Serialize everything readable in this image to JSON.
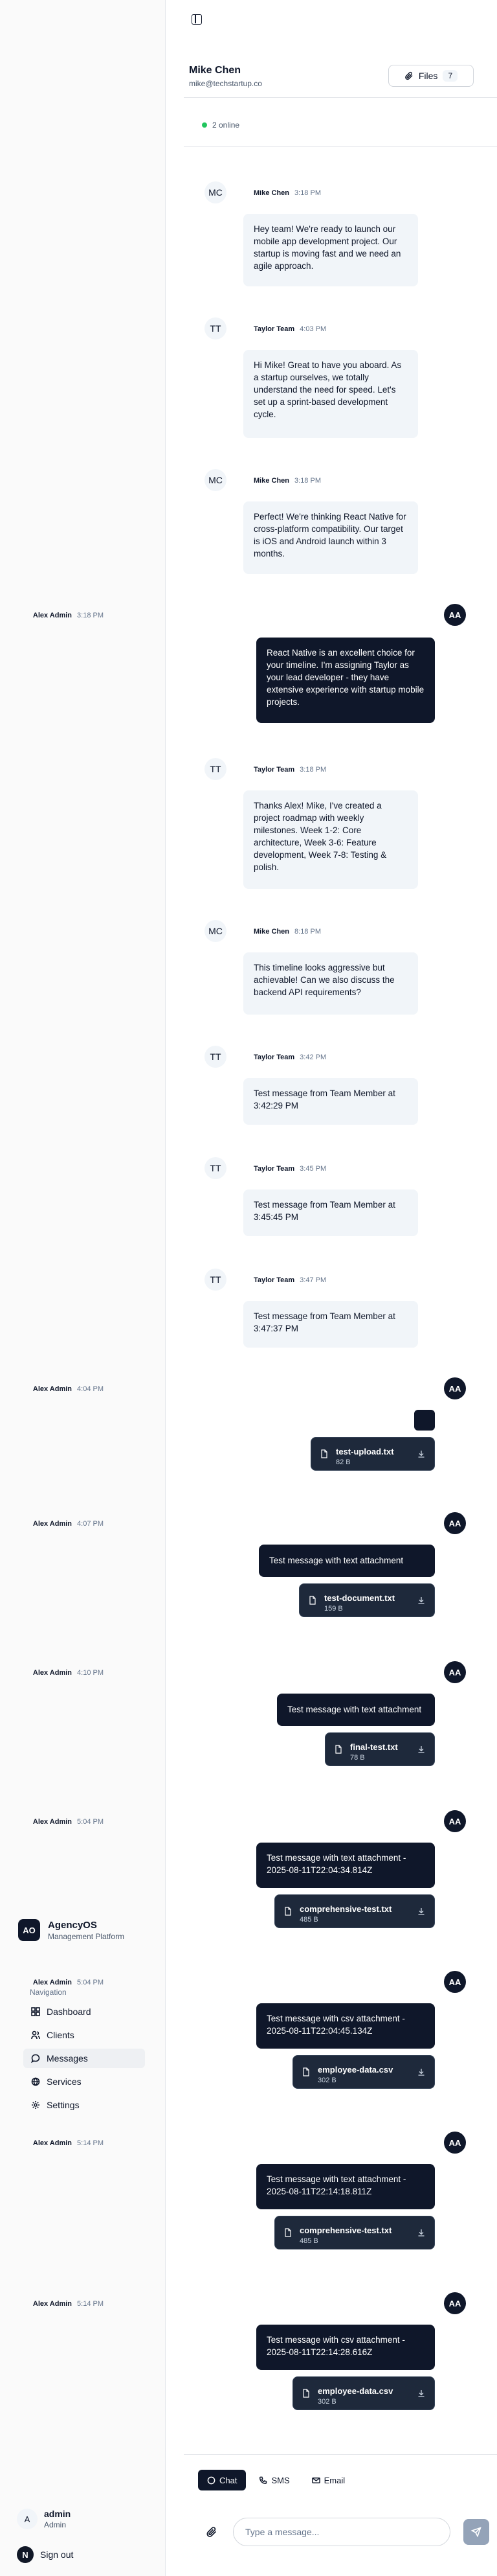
{
  "app": {
    "name": "AgencyOS",
    "subtitle": "Management Platform",
    "logo_text": "AO"
  },
  "sidebar": {
    "heading": "Navigation",
    "items": [
      {
        "label": "Dashboard",
        "icon": "dashboard-icon"
      },
      {
        "label": "Clients",
        "icon": "users-icon"
      },
      {
        "label": "Messages",
        "icon": "chat-icon",
        "active": true
      },
      {
        "label": "Services",
        "icon": "globe-icon"
      },
      {
        "label": "Settings",
        "icon": "gear-icon"
      }
    ],
    "user": {
      "initial": "A",
      "name": "admin",
      "role": "Admin"
    },
    "signout": {
      "badge": "N",
      "label": "Sign out"
    }
  },
  "chat": {
    "contact_name": "Mike Chen",
    "contact_email": "mike@techstartup.co",
    "files_label": "Files",
    "files_count": "7",
    "online_text": "2 online"
  },
  "messages": [
    {
      "avatar": "MC",
      "name": "Mike Chen",
      "time": "3:18 PM",
      "text": "Hey team! We're ready to launch our mobile app development project. Our startup is moving fast and we need an agile approach."
    },
    {
      "avatar": "TT",
      "name": "Taylor Team",
      "time": "4:03 PM",
      "text": "Hi Mike! Great to have you aboard. As a startup ourselves, we totally understand the need for speed. Let's set up a sprint-based development cycle."
    },
    {
      "avatar": "MC",
      "name": "Mike Chen",
      "time": "3:18 PM",
      "text": "Perfect! We're thinking React Native for cross-platform compatibility. Our target is iOS and Android launch within 3 months."
    },
    {
      "avatar": "AA",
      "name": "Alex Admin",
      "time": "3:18 PM",
      "text": "React Native is an excellent choice for your timeline. I'm assigning Taylor as your lead developer - they have extensive experience with startup mobile projects."
    },
    {
      "avatar": "TT",
      "name": "Taylor Team",
      "time": "3:18 PM",
      "text": "Thanks Alex! Mike, I've created a project roadmap with weekly milestones. Week 1-2: Core architecture, Week 3-6: Feature development, Week 7-8: Testing & polish."
    },
    {
      "avatar": "MC",
      "name": "Mike Chen",
      "time": "8:18 PM",
      "text": "This timeline looks aggressive but achievable! Can we also discuss the backend API requirements?"
    },
    {
      "avatar": "TT",
      "name": "Taylor Team",
      "time": "3:42 PM",
      "text": "Test message from Team Member at 3:42:29 PM"
    },
    {
      "avatar": "TT",
      "name": "Taylor Team",
      "time": "3:45 PM",
      "text": "Test message from Team Member at 3:45:45 PM"
    },
    {
      "avatar": "TT",
      "name": "Taylor Team",
      "time": "3:47 PM",
      "text": "Test message from Team Member at 3:47:37 PM"
    },
    {
      "avatar": "AA",
      "name": "Alex Admin",
      "time": "4:04 PM",
      "text": "",
      "file": {
        "name": "test-upload.txt",
        "size": "82 B"
      }
    },
    {
      "avatar": "AA",
      "name": "Alex Admin",
      "time": "4:07 PM",
      "text": "Test message with text attachment",
      "file": {
        "name": "test-document.txt",
        "size": "159 B"
      }
    },
    {
      "avatar": "AA",
      "name": "Alex Admin",
      "time": "4:10 PM",
      "text": "Test message with text attachment",
      "file": {
        "name": "final-test.txt",
        "size": "78 B"
      }
    },
    {
      "avatar": "AA",
      "name": "Alex Admin",
      "time": "5:04 PM",
      "text": "Test message with text attachment - 2025-08-11T22:04:34.814Z",
      "file": {
        "name": "comprehensive-test.txt",
        "size": "485 B"
      }
    },
    {
      "avatar": "AA",
      "name": "Alex Admin",
      "time": "5:04 PM",
      "text": "Test message with csv attachment - 2025-08-11T22:04:45.134Z",
      "file": {
        "name": "employee-data.csv",
        "size": "302 B"
      }
    },
    {
      "avatar": "AA",
      "name": "Alex Admin",
      "time": "5:14 PM",
      "text": "Test message with text attachment - 2025-08-11T22:14:18.811Z",
      "file": {
        "name": "comprehensive-test.txt",
        "size": "485 B"
      }
    },
    {
      "avatar": "AA",
      "name": "Alex Admin",
      "time": "5:14 PM",
      "text": "Test message with csv attachment - 2025-08-11T22:14:28.616Z",
      "file": {
        "name": "employee-data.csv",
        "size": "302 B"
      }
    }
  ],
  "composer": {
    "tabs": [
      {
        "label": "Chat",
        "icon": "chat-icon",
        "active": true
      },
      {
        "label": "SMS",
        "icon": "phone-icon"
      },
      {
        "label": "Email",
        "icon": "mail-icon"
      }
    ],
    "placeholder": "Type a message...",
    "attach_icon": "paperclip-icon",
    "send_icon": "send-icon"
  },
  "colors": {
    "primary": "#0f172a",
    "incoming_bubble": "#f1f5f9",
    "online": "#22c55e",
    "file_card": "#1e293b"
  }
}
